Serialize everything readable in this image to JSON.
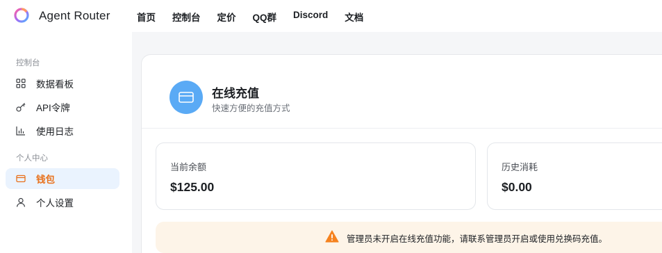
{
  "header": {
    "brand": "Agent Router",
    "nav": [
      "首页",
      "控制台",
      "定价",
      "QQ群",
      "Discord",
      "文档"
    ]
  },
  "sidebar": {
    "group1": "控制台",
    "items1": [
      {
        "label": "数据看板",
        "icon": "dashboard-icon"
      },
      {
        "label": "API令牌",
        "icon": "key-icon"
      },
      {
        "label": "使用日志",
        "icon": "bar-chart-icon"
      }
    ],
    "group2": "个人中心",
    "items2": [
      {
        "label": "钱包",
        "icon": "wallet-icon",
        "active": true
      },
      {
        "label": "个人设置",
        "icon": "user-icon"
      }
    ]
  },
  "main": {
    "title": "在线充值",
    "subtitle": "快速方便的充值方式",
    "cards": [
      {
        "label": "当前余额",
        "value": "$125.00"
      },
      {
        "label": "历史消耗",
        "value": "$0.00"
      }
    ],
    "notice": "管理员未开启在线充值功能，请联系管理员开启或使用兑换码充值。"
  },
  "colors": {
    "accent_orange": "#e8701a",
    "active_bg": "#eaf3fe",
    "icon_circle": "#5aaaf5",
    "notice_bg": "#fdf4e8",
    "warning": "#f5821f"
  }
}
